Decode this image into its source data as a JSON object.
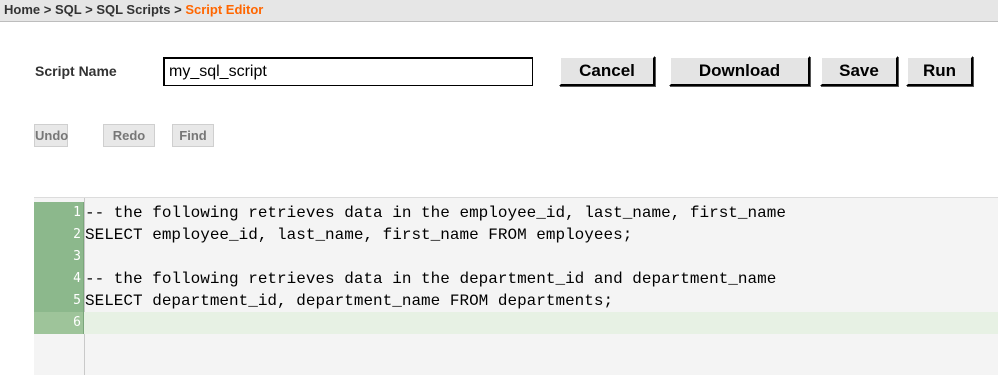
{
  "breadcrumb": {
    "items": [
      "Home",
      "SQL",
      "SQL Scripts"
    ],
    "current": "Script Editor",
    "separator": ">"
  },
  "form": {
    "script_name_label": "Script Name",
    "script_name_value": "my_sql_script"
  },
  "toolbar": {
    "cancel_label": "Cancel",
    "download_label": "Download",
    "save_label": "Save",
    "run_label": "Run"
  },
  "editor_toolbar": {
    "undo_label": "Undo",
    "redo_label": "Redo",
    "find_label": "Find"
  },
  "editor": {
    "lines": [
      {
        "number": "1",
        "text": "-- the following retrieves data in the employee_id, last_name, first_name"
      },
      {
        "number": "2",
        "text": "SELECT employee_id, last_name, first_name FROM employees;"
      },
      {
        "number": "3",
        "text": ""
      },
      {
        "number": "4",
        "text": "-- the following retrieves data in the department_id and department_name"
      },
      {
        "number": "5",
        "text": "SELECT department_id, department_name FROM departments;"
      },
      {
        "number": "6",
        "text": ""
      }
    ],
    "active_line": 6
  },
  "colors": {
    "accent": "#ff6600",
    "gutter": "#8cb88c",
    "active_line_bg": "#e7f1e4"
  }
}
